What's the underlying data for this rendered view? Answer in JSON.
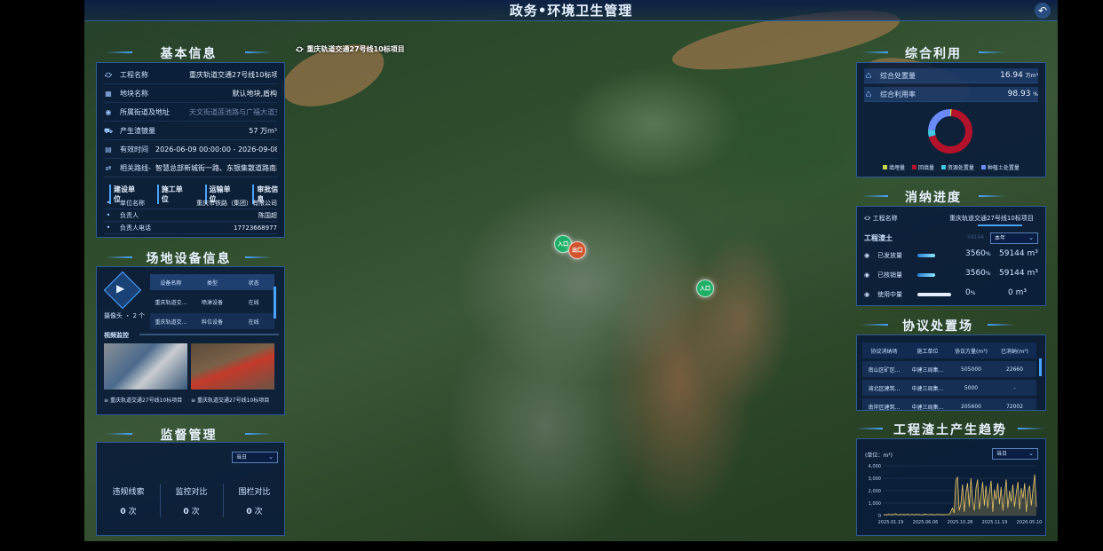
{
  "header": {
    "title": "政务•环境卫生管理",
    "back_icon": "back-arrow-icon"
  },
  "map": {
    "project_label": "重庆轨道交通27号线10标项目",
    "markers": [
      {
        "label": "入口",
        "kind": "entry"
      },
      {
        "label": "出口",
        "kind": "exit"
      },
      {
        "label": "入口",
        "kind": "entry"
      }
    ]
  },
  "basic_info": {
    "title": "基本信息",
    "rows": [
      {
        "icon": "crane-icon",
        "label": "工程名称",
        "value": "重庆轨道交通27号线10标项目"
      },
      {
        "icon": "grid-icon",
        "label": "地块名称",
        "value": "默认地块,盾构"
      },
      {
        "icon": "location-icon",
        "label": "所属街道及地址",
        "value": "天文街道莲池路与广福大道交汇处/",
        "dim": true
      },
      {
        "icon": "truck-icon",
        "label": "产生渣镀量",
        "value": "57 万m³"
      },
      {
        "icon": "calendar-icon",
        "label": "有效时间",
        "value": "2026-06-09 00:00:00 - 2026-09-08 23:59"
      },
      {
        "icon": "route-icon",
        "label": "相关路线-",
        "value": "智慧总部新城街一路、东银集散道路南段..."
      }
    ],
    "tabs": [
      "建设单位",
      "施工单位",
      "运输单位",
      "审批信息"
    ],
    "detail": [
      {
        "label": "单位名称",
        "value": "重庆市铁路（集团）有限公司"
      },
      {
        "label": "负责人",
        "value": "陈国超"
      },
      {
        "label": "负责人电话",
        "value": "17723668977"
      }
    ]
  },
  "equipment": {
    "title": "场地设备信息",
    "camera_label": "摄像头 ・ 2 个",
    "columns": [
      "设备名称",
      "类型",
      "状态"
    ],
    "rows": [
      [
        "重庆轨道交...",
        "喷淋设备",
        "在线"
      ],
      [
        "重庆轨道交...",
        "料位设备",
        "在线"
      ]
    ],
    "video_title": "视频监控",
    "videos": [
      "重庆轨道交通27号线10标项目",
      "重庆轨道交通27号线10标项目"
    ]
  },
  "supervision": {
    "title": "监督管理",
    "dropdown": "当日",
    "stats": [
      {
        "label": "违规线索",
        "value": "0",
        "unit": "次"
      },
      {
        "label": "监控对比",
        "value": "0",
        "unit": "次"
      },
      {
        "label": "围栏对比",
        "value": "0",
        "unit": "次"
      }
    ]
  },
  "utilization": {
    "title": "综合利用",
    "rows": [
      {
        "label": "综合处置量",
        "value": "16.94",
        "unit": "万m³"
      },
      {
        "label": "综合利用率",
        "value": "98.93",
        "unit": "%"
      }
    ],
    "legend": [
      {
        "name": "填埋量",
        "color": "#c8d84a"
      },
      {
        "name": "回填量",
        "color": "#b3122a"
      },
      {
        "name": "资源处置量",
        "color": "#3fc7e0"
      },
      {
        "name": "种植土处置量",
        "color": "#6b8cff"
      }
    ],
    "donut": [
      {
        "name": "填埋量",
        "value": 1,
        "color": "#c8d84a"
      },
      {
        "name": "回填量",
        "value": 70,
        "color": "#b3122a"
      },
      {
        "name": "资源处置量",
        "value": 5,
        "color": "#3fc7e0"
      },
      {
        "name": "种植土处置量",
        "value": 24,
        "color": "#6b8cff"
      }
    ]
  },
  "consumption": {
    "title": "消纳进度",
    "project_label": "工程名称",
    "project_value": "重庆轨道交通27号线10标项目",
    "sub_label": "工程渣土",
    "sub_value": "59144",
    "dropdown": "本年",
    "rows": [
      {
        "label": "已发放量",
        "value": "3560",
        "unit": "%",
        "total": "59144 m³",
        "fill": 0.4
      },
      {
        "label": "已核销量",
        "value": "3560",
        "unit": "%",
        "total": "59144 m³",
        "fill": 0.4
      },
      {
        "label": "使用中量",
        "value": "0",
        "unit": "%",
        "total": "0 m³",
        "fill": 0.75
      }
    ]
  },
  "agreement": {
    "title": "协议处置场",
    "columns": [
      "协议消纳场",
      "施工单位",
      "协议方量(m³)",
      "已消纳(m³)"
    ],
    "rows": [
      [
        "南山区矿区...",
        "中建三局集...",
        "505000",
        "22660"
      ],
      [
        "渝北区建筑...",
        "中建三局集...",
        "5000",
        "-"
      ],
      [
        "南岸区建筑...",
        "中建三局集...",
        "205600",
        "72002"
      ]
    ]
  },
  "trend": {
    "title": "工程渣土产生趋势",
    "unit_label": "(单位：m³)",
    "dropdown": "当日"
  },
  "chart_data": {
    "type": "line",
    "title": "工程渣土产生趋势",
    "ylabel": "(单位：m³)",
    "ylim": [
      0,
      4000
    ],
    "yticks": [
      "0",
      "1,000",
      "2,000",
      "3,000",
      "4,000"
    ],
    "xticks": [
      "2025.01.19",
      "2025.06.06",
      "2025.10.28",
      "2025.11.19",
      "2026.05.10"
    ],
    "values": [
      60,
      80,
      50,
      120,
      60,
      90,
      70,
      150,
      80,
      60,
      100,
      70,
      90,
      60,
      120,
      80,
      70,
      110,
      60,
      90,
      80,
      100,
      70,
      60,
      90,
      120,
      80,
      70,
      100,
      90,
      60,
      80,
      110,
      70,
      90,
      60,
      100,
      80,
      70,
      90,
      300,
      600,
      200,
      2800,
      3100,
      400,
      900,
      2500,
      300,
      1800,
      2600,
      700,
      3000,
      1200,
      400,
      2200,
      2900,
      500,
      1500,
      2700,
      800,
      2400,
      600,
      1900,
      2800,
      300,
      2100,
      1300,
      2600,
      900,
      2300,
      400,
      1700,
      2900,
      600,
      2000,
      1100,
      2500,
      700,
      1800,
      2700,
      500,
      2200,
      1400,
      2600,
      300,
      1900,
      2400,
      800,
      2100,
      3300,
      700
    ]
  }
}
